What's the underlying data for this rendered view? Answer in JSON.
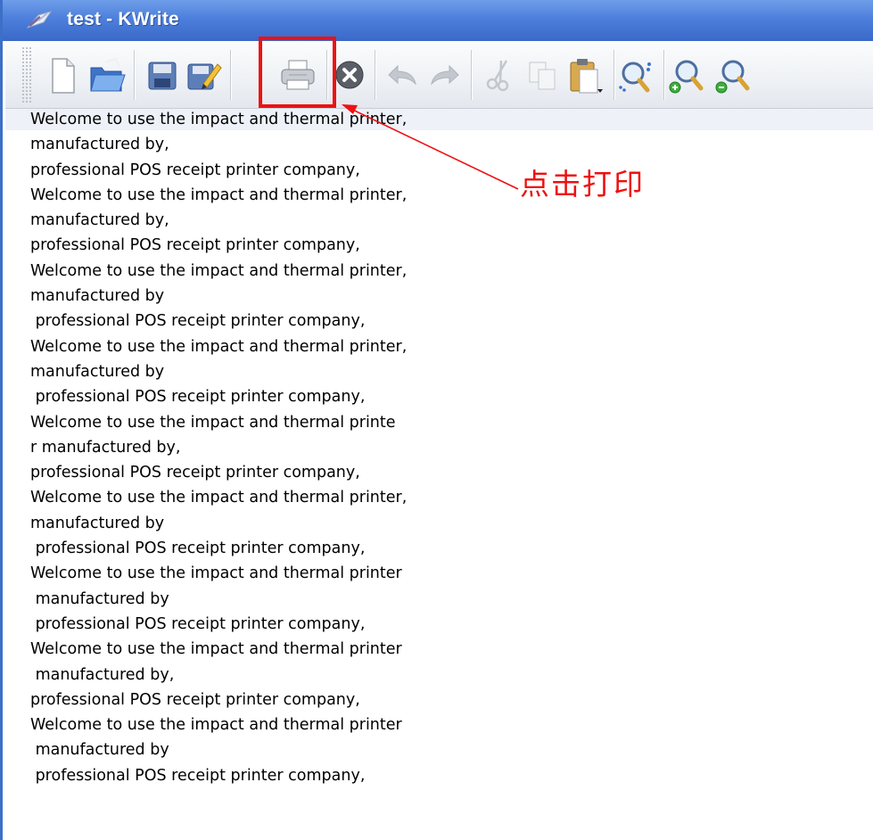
{
  "window": {
    "title": "test - KWrite",
    "app_icon": "kwrite-quill-icon"
  },
  "toolbar": {
    "buttons": [
      {
        "name": "new-document-button",
        "icon": "new-document-icon",
        "label": "New"
      },
      {
        "name": "open-button",
        "icon": "open-folder-icon",
        "label": "Open"
      },
      {
        "name": "save-button",
        "icon": "floppy-disk-icon",
        "label": "Save"
      },
      {
        "name": "save-as-button",
        "icon": "save-as-icon",
        "label": "Save As"
      },
      {
        "name": "print-button",
        "icon": "printer-icon",
        "label": "Print"
      },
      {
        "name": "close-button",
        "icon": "close-circle-icon",
        "label": "Close"
      },
      {
        "name": "undo-button",
        "icon": "undo-arrow-icon",
        "label": "Undo"
      },
      {
        "name": "redo-button",
        "icon": "redo-arrow-icon",
        "label": "Redo"
      },
      {
        "name": "cut-button",
        "icon": "scissors-icon",
        "label": "Cut"
      },
      {
        "name": "copy-button",
        "icon": "copy-icon",
        "label": "Copy"
      },
      {
        "name": "paste-button",
        "icon": "clipboard-icon",
        "label": "Paste"
      },
      {
        "name": "find-button",
        "icon": "find-magnifier-icon",
        "label": "Find"
      },
      {
        "name": "zoom-in-button",
        "icon": "zoom-in-icon",
        "label": "Zoom In"
      },
      {
        "name": "zoom-out-button",
        "icon": "zoom-out-icon",
        "label": "Zoom Out"
      }
    ]
  },
  "annotation": {
    "text": "点击打印",
    "color": "#ee1111"
  },
  "editor": {
    "lines": [
      "Welcome to use the impact and thermal printer,",
      "manufactured by,",
      "professional POS receipt printer company,",
      "Welcome to use the impact and thermal printer,",
      "manufactured by,",
      "professional POS receipt printer company,",
      "Welcome to use the impact and thermal printer,",
      "manufactured by",
      " professional POS receipt printer company,",
      "Welcome to use the impact and thermal printer,",
      "manufactured by",
      " professional POS receipt printer company,",
      "Welcome to use the impact and thermal printe",
      "r manufactured by,",
      "professional POS receipt printer company,",
      "Welcome to use the impact and thermal printer,",
      "manufactured by",
      " professional POS receipt printer company,",
      "Welcome to use the impact and thermal printer",
      " manufactured by",
      " professional POS receipt printer company,",
      "Welcome to use the impact and thermal printer",
      " manufactured by,",
      "professional POS receipt printer company,",
      "Welcome to use the impact and thermal printer",
      " manufactured by",
      " professional POS receipt printer company,"
    ]
  }
}
